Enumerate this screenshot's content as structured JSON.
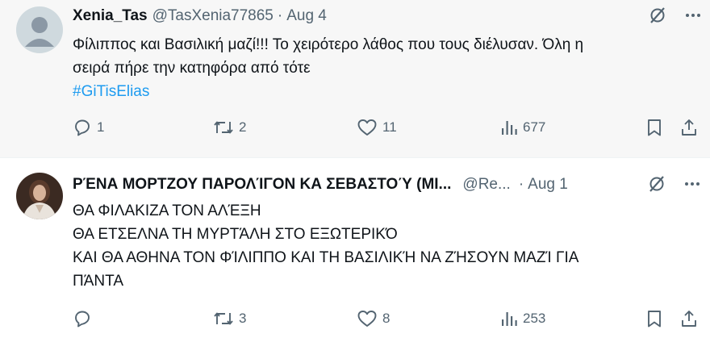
{
  "tweets": [
    {
      "name": "Xenia_Tas",
      "handle": "@TasXenia77865",
      "separator": "·",
      "date": "Aug 4",
      "text_lines": [
        "Φίλιππος και Βασιλική μαζί!!! Το χειρότερο λάθος που τους διέλυσαν. Όλη η",
        "σειρά πήρε την κατηφόρα από τότε"
      ],
      "hashtag": "#GiTisElias",
      "replies": "1",
      "reposts": "2",
      "likes": "11",
      "views": "677"
    },
    {
      "name": "ΡΈΝΑ ΜΟΡΤΖΟΥ ΠΑΡΟΛΊΓΟΝ ΚΑ ΣΕΒΑΣΤΟΎ (ΜΙ...",
      "handle": "@Re...",
      "separator": "·",
      "date": "Aug 1",
      "text_lines": [
        "ΘΑ ΦΙΛΑΚΙΖΑ ΤΟΝ ΑΛΈΞΗ",
        "ΘΑ ΕΤΣΕΛΝΑ ΤΗ ΜΥΡΤΆΛΗ ΣΤΟ ΕΞΩΤΕΡΙΚΌ",
        "ΚΑΙ ΘΑ ΑΘΗΝΑ ΤΟΝ ΦΊΛΙΠΠΟ ΚΑΙ ΤΗ ΒΑΣΙΛΙΚΉ ΝΑ ΖΉΣΟΥΝ ΜΑΖΊ ΓΙΑ",
        "ΠΆΝΤΑ"
      ],
      "replies": "",
      "reposts": "3",
      "likes": "8",
      "views": "253"
    }
  ],
  "icons": [
    "grok-icon",
    "more-icon",
    "reply-icon",
    "repost-icon",
    "like-icon",
    "views-icon",
    "bookmark-icon",
    "share-icon"
  ],
  "colors": {
    "accent": "#1d9bf0",
    "secondary_text": "#536471",
    "primary_text": "#0f1419",
    "selected_background": "#f7f7f7"
  }
}
